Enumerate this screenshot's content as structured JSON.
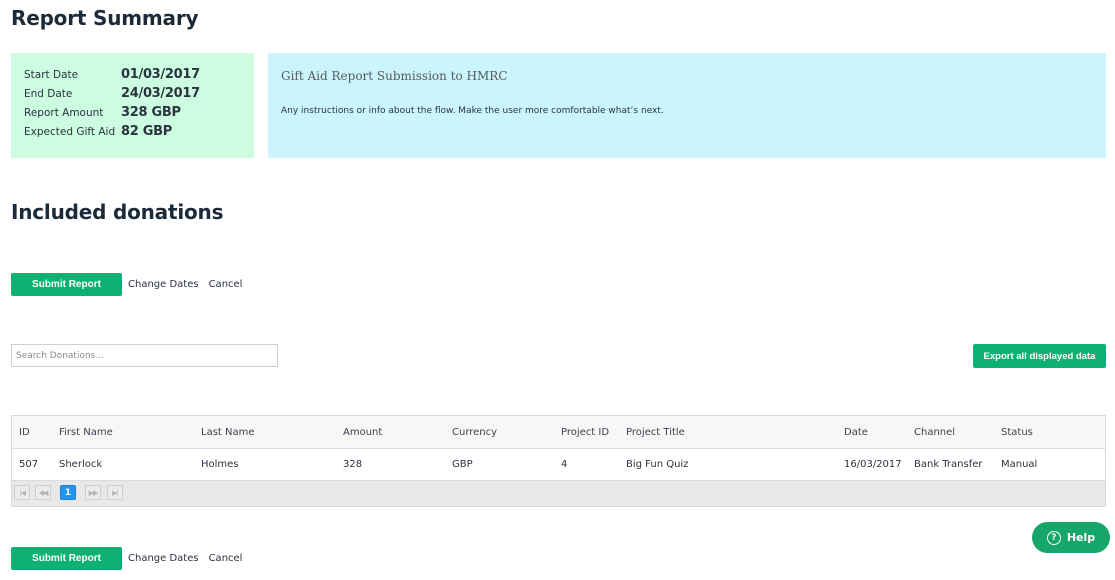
{
  "page": {
    "title": "Report Summary",
    "section_title": "Included donations"
  },
  "summary": {
    "rows": [
      {
        "label": "Start Date",
        "value": "01/03/2017"
      },
      {
        "label": "End Date",
        "value": "24/03/2017"
      },
      {
        "label": "Report Amount",
        "value": "328 GBP"
      },
      {
        "label": "Expected Gift Aid",
        "value": "82 GBP"
      }
    ]
  },
  "info": {
    "title": "Gift Aid Report Submission to HMRC",
    "text": "Any instructions or info about the flow. Make the user more comfortable what’s next."
  },
  "actions": {
    "submit_label": "Submit Report",
    "change_dates_label": "Change Dates",
    "cancel_label": "Cancel"
  },
  "search": {
    "placeholder": "Search Donations...",
    "value": ""
  },
  "export": {
    "label": "Export all displayed data"
  },
  "table": {
    "columns": [
      "ID",
      "First Name",
      "Last Name",
      "Amount",
      "Currency",
      "Project ID",
      "Project Title",
      "Date",
      "Channel",
      "Status"
    ],
    "rows": [
      [
        "507",
        "Sherlock",
        "Holmes",
        "328",
        "GBP",
        "4",
        "Big Fun Quiz",
        "16/03/2017",
        "Bank Transfer",
        "Manual"
      ]
    ]
  },
  "pager": {
    "first_icon": "first-page-icon",
    "prev_icon": "prev-page-icon",
    "current_page": "1",
    "next_icon": "next-page-icon",
    "last_icon": "last-page-icon"
  },
  "help": {
    "label": "Help",
    "icon": "question-circle-icon",
    "icon_glyph": "?"
  },
  "colors": {
    "accent_green": "#0db173",
    "summary_bg": "#ccfde0",
    "info_bg": "#cbf5fc",
    "pager_active": "#2196f3"
  }
}
